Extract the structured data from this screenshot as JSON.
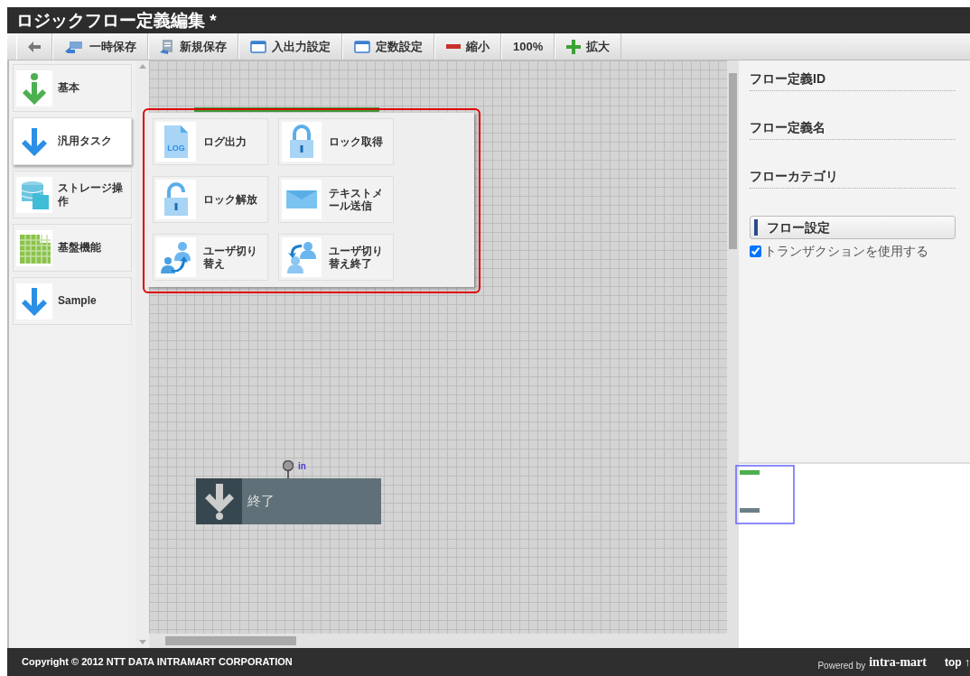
{
  "window": {
    "title": "ロジックフロー定義編集",
    "modified_mark": "*"
  },
  "toolbar": [
    {
      "kind": "back"
    },
    {
      "kind": "save",
      "label": "一時保存"
    },
    {
      "kind": "new",
      "label": "新規保存"
    },
    {
      "kind": "window",
      "label": "入出力設定"
    },
    {
      "kind": "window",
      "label": "定数設定"
    },
    {
      "kind": "minus",
      "label": "縮小"
    },
    {
      "kind": "text",
      "label": "100%"
    },
    {
      "kind": "plus",
      "label": "拡大"
    }
  ],
  "palette": {
    "categories": [
      {
        "label": "基本",
        "kind": "basic",
        "selected": false
      },
      {
        "label": "汎用タスク",
        "kind": "general",
        "selected": true
      },
      {
        "label": "ストレージ操作",
        "kind": "storage",
        "selected": false
      },
      {
        "label": "基盤機能",
        "kind": "platform",
        "selected": false
      },
      {
        "label": "Sample",
        "kind": "general",
        "selected": false
      }
    ],
    "tasks": [
      {
        "label": "ログ出力",
        "kind": "log",
        "icon_text": "LOG"
      },
      {
        "label": "ロック取得",
        "kind": "lock"
      },
      {
        "label": "ロック解放",
        "kind": "unlock"
      },
      {
        "label": "テキストメール送信",
        "kind": "mail"
      },
      {
        "label": "ユーザ切り替え",
        "kind": "switch"
      },
      {
        "label": "ユーザ切り替え終了",
        "kind": "unswitch"
      }
    ]
  },
  "canvas": {
    "nodes": [
      {
        "kind": "start"
      },
      {
        "kind": "end",
        "label": "終了",
        "port": "in"
      }
    ]
  },
  "properties": {
    "fields": [
      {
        "label": "フロー定義ID"
      },
      {
        "label": "フロー定義名"
      },
      {
        "label": "フローカテゴリ"
      }
    ],
    "section": "フロー設定",
    "checkbox": {
      "label": "トランザクションを使用する",
      "checked": true
    }
  },
  "footer": {
    "copyright": "Copyright © 2012 NTT DATA INTRAMART CORPORATION",
    "powered_by": "Powered by",
    "logo": "intra-mart",
    "top_link": "top ↑"
  }
}
